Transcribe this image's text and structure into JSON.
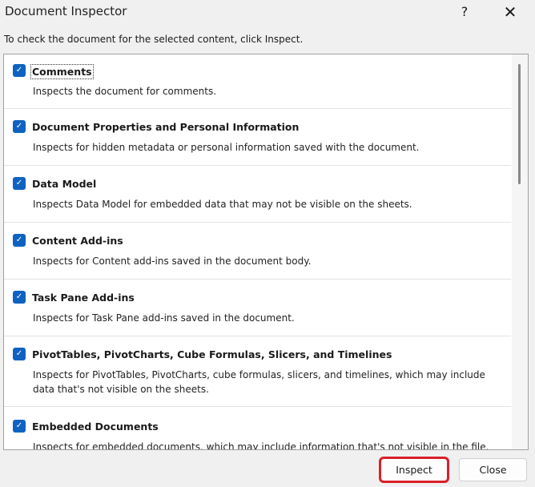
{
  "window": {
    "title": "Document Inspector",
    "help": "?",
    "close": "✕"
  },
  "instruction": "To check the document for the selected content, click Inspect.",
  "items": [
    {
      "label": "Comments",
      "desc": "Inspects the document for comments.",
      "checked": true
    },
    {
      "label": "Document Properties and Personal Information",
      "desc": "Inspects for hidden metadata or personal information saved with the document.",
      "checked": true
    },
    {
      "label": "Data Model",
      "desc": "Inspects Data Model for embedded data that may not be visible on the sheets.",
      "checked": true
    },
    {
      "label": "Content Add-ins",
      "desc": "Inspects for Content add-ins saved in the document body.",
      "checked": true
    },
    {
      "label": "Task Pane Add-ins",
      "desc": "Inspects for Task Pane add-ins saved in the document.",
      "checked": true
    },
    {
      "label": "PivotTables, PivotCharts, Cube Formulas, Slicers, and Timelines",
      "desc": "Inspects for PivotTables, PivotCharts, cube formulas, slicers, and timelines, which may include data that's not visible on the sheets.",
      "checked": true
    },
    {
      "label": "Embedded Documents",
      "desc": "Inspects for embedded documents, which may include information that's not visible in the file.",
      "checked": true
    }
  ],
  "buttons": {
    "inspect": "Inspect",
    "close": "Close"
  },
  "colors": {
    "accent": "#0f62c1",
    "highlight": "#d9202a"
  }
}
